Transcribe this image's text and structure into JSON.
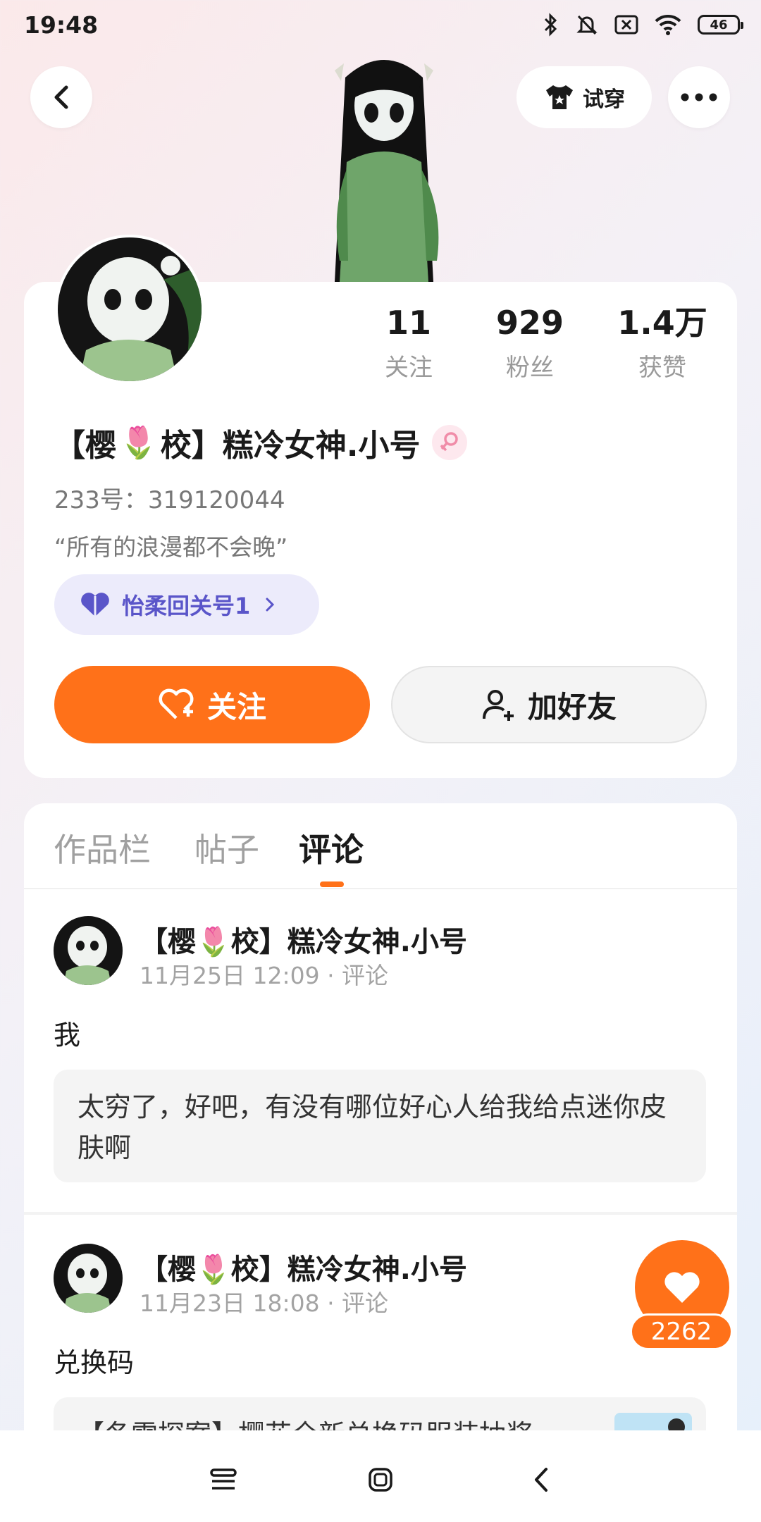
{
  "status_bar": {
    "time": "19:48",
    "battery": "46",
    "icons": [
      "bluetooth-icon",
      "bell-muted-icon",
      "sim-off-icon",
      "wifi-icon",
      "battery-icon"
    ]
  },
  "header": {
    "back_icon": "back-arrow-icon",
    "tryon_label": "试穿",
    "tryon_icon": "tshirt-icon",
    "more_icon": "more-dots-icon"
  },
  "profile": {
    "stats": [
      {
        "value": "11",
        "label": "关注"
      },
      {
        "value": "929",
        "label": "粉丝"
      },
      {
        "value": "1.4万",
        "label": "获赞"
      }
    ],
    "name_prefix": "【樱",
    "name_flower": "🌷",
    "name_suffix": "校】糕冷女神.小号",
    "gender_icon": "female-icon",
    "uid": "233号：319120044",
    "bio": "“所有的浪漫都不会晚”",
    "tag_label": "怡柔回关号1",
    "follow_label": "关注",
    "add_friend_label": "加好友",
    "accent_color": "#ff7119"
  },
  "tabs": [
    {
      "label": "作品栏",
      "active": false
    },
    {
      "label": "帖子",
      "active": false
    },
    {
      "label": "评论",
      "active": true
    }
  ],
  "posts": [
    {
      "author": "【樱🌷校】糕冷女神.小号",
      "meta": "11月25日 12:09 · 评论",
      "text": "我",
      "quote": "太穷了，好吧，有没有哪位好心人给我给点迷你皮肤啊"
    },
    {
      "author": "【樱🌷校】糕冷女神.小号",
      "meta": "11月23日 18:08 · 评论",
      "text": "兑换码",
      "quote": "【冬雪探案】樱花全新兑换码服装抽奖"
    }
  ],
  "like": {
    "count": "2262"
  },
  "nav": [
    "menu-icon",
    "home-icon",
    "back-icon"
  ]
}
